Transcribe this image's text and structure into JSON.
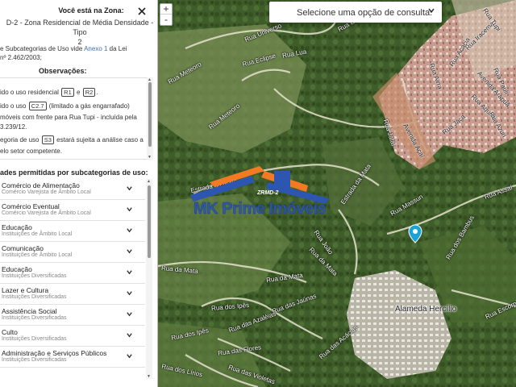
{
  "panel": {
    "title": "Você está na Zona:",
    "zone_line1": "D-2 - Zona Residencial de Média Densidade - Tipo",
    "zone_line2": "2",
    "anexo_prefix": "e Subcategorias de Uso vide",
    "anexo_link": "Anexo 1",
    "anexo_suffix": "da Lei",
    "anexo_line2": "nº 2.462/2003;",
    "obs_title": "Observações:",
    "obs": {
      "l1_pre": "ido o uso residencial",
      "tag_r1": "R1",
      "l1_mid": "e",
      "tag_r2": "R2",
      "l1_end": ".",
      "l2_pre": "ido o uso",
      "tag_c27": "C2.7",
      "l2_end": "(limitado a gás engarrafado)",
      "l3": "móveis com frente para Rua Tupi - incluída pela",
      "l4": "3.239/12.",
      "l5_pre": "egoria de uso",
      "tag_s3": "S3",
      "l5_end": "estará sujeita a análise caso a",
      "l6": "elo setor competente."
    },
    "activities_title": "ades permitidas por subcategorias de uso:",
    "items": [
      {
        "name": "Comércio de Alimentação",
        "sub": "Comércio Varejista de Âmbito Local"
      },
      {
        "name": "Comércio Eventual",
        "sub": "Comércio Varejista de Âmbito Local"
      },
      {
        "name": "Educação",
        "sub": "Instituições de Âmbito Local"
      },
      {
        "name": "Comunicação",
        "sub": "Instituições de Âmbito Local"
      },
      {
        "name": "Educação",
        "sub": "Instituições Diversificadas"
      },
      {
        "name": "Lazer e Cultura",
        "sub": "Instituições Diversificadas"
      },
      {
        "name": "Assistência Social",
        "sub": "Instituições Diversificadas"
      },
      {
        "name": "Culto",
        "sub": "Instituições Diversificadas"
      },
      {
        "name": "Administração e Serviços Públicos",
        "sub": "Instituições Diversificadas"
      }
    ]
  },
  "map": {
    "zoom_in": "+",
    "zoom_out": "-",
    "consult_placeholder": "Selecione uma opção de consulta:",
    "watermark_brand": "MK Prime Imóveis",
    "watermark_tag": "ZRMD-2",
    "alameda": "Alameda Hercílio",
    "roads": {
      "universo": "Rua Universo",
      "meteoro": "Rua Meteoro",
      "meteoro2": "Rua Meteoro",
      "eclipse": "Rua Eclipse",
      "lua": "Rua Lua",
      "eu": "Rua Éu",
      "acai": "Avenida Açaí",
      "jatai": "Rua Jataí",
      "estrada": "Estrada da Mata",
      "estrada2": "Estrada da Mata",
      "mata": "Rua da Mata",
      "mata2": "Rua da Mata",
      "mata3": "Rua da Mata",
      "jaunas": "Rua das Jaúnas",
      "azaleias": "Rua das Azaléias",
      "violetas": "Rua das Violetas",
      "flores": "Rua das Flores",
      "ipes": "Rua dos Ipês",
      "lirios": "Rua dos Lírios",
      "ipes2": "Rua dos Ipês",
      "acacias": "Rua das Acácias",
      "joao": "Rua João",
      "massun": "Rua Massun",
      "assai": "Rua Assaí",
      "escorp": "Rua Escorpião",
      "bambus": "Rua dos Bambus",
      "iracema": "Rua Iracema",
      "acacia": "Rua Acácia",
      "arapua": "Avenida Arapuã",
      "aquira": "Rua Aquirá",
      "azuri": "Rua Azuri",
      "tupi": "Rua Tupi",
      "pauli": "Rua Pauli",
      "airra": "Rua Airra",
      "jaca": "Rua Jaca"
    }
  }
}
